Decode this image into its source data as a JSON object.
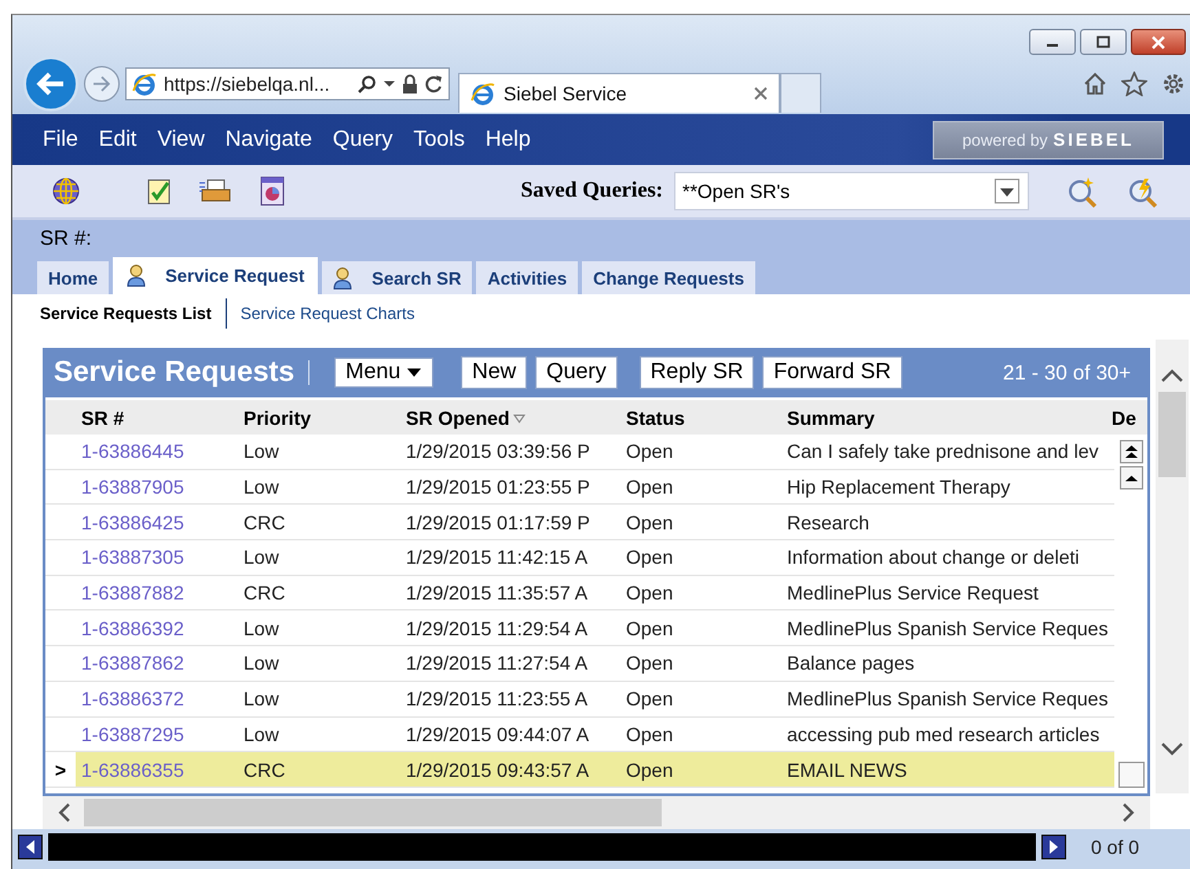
{
  "browser": {
    "address": "https://siebelqa.nl...",
    "tab_title": "Siebel Service"
  },
  "menu": [
    "File",
    "Edit",
    "View",
    "Navigate",
    "Query",
    "Tools",
    "Help"
  ],
  "logo": {
    "prefix": "powered by",
    "name": "SIEBEL"
  },
  "saved_queries": {
    "label": "Saved Queries:",
    "value": "**Open SR's"
  },
  "sr_bar": {
    "label": "SR #:"
  },
  "tabs": [
    {
      "label": "Home",
      "selected": false,
      "has_icon": false
    },
    {
      "label": "Service Request",
      "selected": true,
      "has_icon": true
    },
    {
      "label": "Search SR",
      "selected": false,
      "has_icon": true
    },
    {
      "label": "Activities",
      "selected": false,
      "has_icon": false
    },
    {
      "label": "Change Requests",
      "selected": false,
      "has_icon": false
    }
  ],
  "subtabs": [
    {
      "label": "Service Requests List",
      "selected": true
    },
    {
      "label": "Service Request Charts",
      "selected": false
    }
  ],
  "applet": {
    "title": "Service Requests",
    "menu_button": "Menu",
    "buttons": [
      "New",
      "Query",
      "Reply SR",
      "Forward SR"
    ],
    "count": "21 - 30 of 30+"
  },
  "table": {
    "columns": [
      {
        "label": "SR #",
        "sorted": false
      },
      {
        "label": "Priority",
        "sorted": false
      },
      {
        "label": "SR Opened",
        "sorted": true
      },
      {
        "label": "Status",
        "sorted": false
      },
      {
        "label": "Summary",
        "sorted": false
      },
      {
        "label": "De",
        "sorted": false
      }
    ],
    "rows": [
      {
        "sr": "1-63886445",
        "priority": "Low",
        "opened": "1/29/2015 03:39:56 P",
        "status": "Open",
        "summary": "Can I safely take prednisone and lev",
        "selected": false
      },
      {
        "sr": "1-63887905",
        "priority": "Low",
        "opened": "1/29/2015 01:23:55 P",
        "status": "Open",
        "summary": "Hip Replacement Therapy",
        "selected": false
      },
      {
        "sr": "1-63886425",
        "priority": "CRC",
        "opened": "1/29/2015 01:17:59 P",
        "status": "Open",
        "summary": "Research",
        "selected": false
      },
      {
        "sr": "1-63887305",
        "priority": "Low",
        "opened": "1/29/2015 11:42:15 A",
        "status": "Open",
        "summary": "Information about change or deleti",
        "selected": false
      },
      {
        "sr": "1-63887882",
        "priority": "CRC",
        "opened": "1/29/2015 11:35:57 A",
        "status": "Open",
        "summary": "MedlinePlus Service Request",
        "selected": false
      },
      {
        "sr": "1-63886392",
        "priority": "Low",
        "opened": "1/29/2015 11:29:54 A",
        "status": "Open",
        "summary": "MedlinePlus Spanish Service Reques",
        "selected": false
      },
      {
        "sr": "1-63887862",
        "priority": "Low",
        "opened": "1/29/2015 11:27:54 A",
        "status": "Open",
        "summary": "Balance pages",
        "selected": false
      },
      {
        "sr": "1-63886372",
        "priority": "Low",
        "opened": "1/29/2015 11:23:55 A",
        "status": "Open",
        "summary": "MedlinePlus Spanish Service Reques",
        "selected": false
      },
      {
        "sr": "1-63887295",
        "priority": "Low",
        "opened": "1/29/2015 09:44:07 A",
        "status": "Open",
        "summary": "accessing pub med research articles",
        "selected": false
      },
      {
        "sr": "1-63886355",
        "priority": "CRC",
        "opened": "1/29/2015 09:43:57 A",
        "status": "Open",
        "summary": "EMAIL NEWS",
        "selected": true
      }
    ]
  },
  "row_marker": ">",
  "pager": {
    "count": "0 of 0"
  }
}
